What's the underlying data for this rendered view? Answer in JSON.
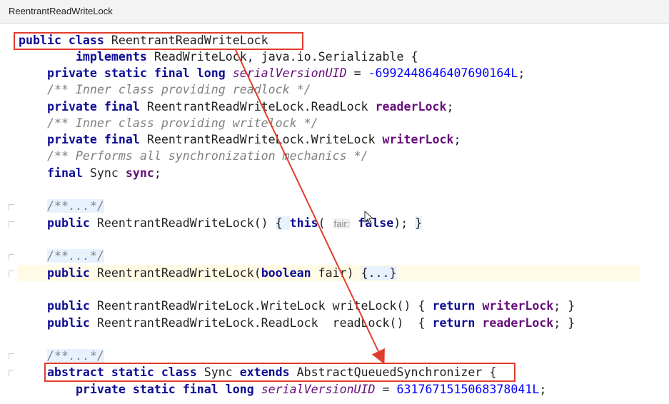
{
  "tab": {
    "title": "ReentrantReadWriteLock"
  },
  "code": {
    "l1_kw": "public class ",
    "l1_name": "ReentrantReadWriteLock",
    "l2_kw": "implements ",
    "l2_rest": "ReadWriteLock, java.io.Serializable {",
    "l3_kw": "private static final long ",
    "l3_field": "serialVersionUID",
    "l3_eq": " = ",
    "l3_val": "-6992448646407690164L",
    "l3_end": ";",
    "l4": "/** Inner class providing readlock */",
    "l5_kw": "private final ",
    "l5_type": "ReentrantReadWriteLock.ReadLock ",
    "l5_field": "readerLock",
    "l5_end": ";",
    "l6": "/** Inner class providing writelock */",
    "l7_kw": "private final ",
    "l7_type": "ReentrantReadWriteLock.WriteLock ",
    "l7_field": "writerLock",
    "l7_end": ";",
    "l8": "/** Performs all synchronization mechanics */",
    "l9_kw": "final ",
    "l9_type": "Sync ",
    "l9_field": "sync",
    "l9_end": ";",
    "l10": "/**...*/",
    "l11_kw": "public ",
    "l11_sig": "ReentrantReadWriteLock() ",
    "l11_open": "{ ",
    "l11_this": "this",
    "l11_paren": "( ",
    "l11_hint": "fair:",
    "l11_false": "false",
    "l11_end": "); ",
    "l11_close": "}",
    "l12": "/**...*/",
    "l13_kw": "public ",
    "l13_sig": "ReentrantReadWriteLock(",
    "l13_bool": "boolean ",
    "l13_param": "fair) ",
    "l13_body": "{...}",
    "l14_kw": "public ",
    "l14_sig": "ReentrantReadWriteLock.WriteLock writeLock() { ",
    "l14_ret": "return ",
    "l14_field": "writerLock",
    "l14_end": "; }",
    "l15_kw": "public ",
    "l15_sig": "ReentrantReadWriteLock.ReadLock  readLock()  { ",
    "l15_ret": "return ",
    "l15_field": "readerLock",
    "l15_end": "; }",
    "l16": "/**...*/",
    "l17_kw": "abstract static class ",
    "l17_name": "Sync ",
    "l17_ext": "extends ",
    "l17_super": "AbstractQueuedSynchronizer",
    "l17_brace": " {",
    "l18_kw": "private static final long ",
    "l18_field": "serialVersionUID",
    "l18_eq": " = ",
    "l18_val": "6317671515068378041L",
    "l18_end": ";"
  },
  "colors": {
    "annotation": "#e03c2c",
    "keyword": "#0c0c95",
    "comment": "#808080",
    "field": "#660e7a",
    "number": "#0000ff"
  }
}
